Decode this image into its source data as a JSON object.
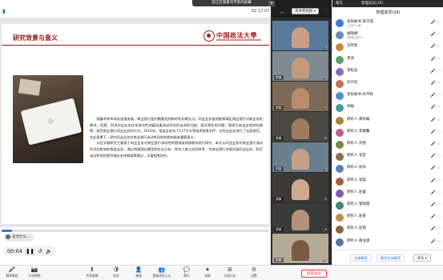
{
  "banner": {
    "text": "您正在观看刘宇新的屏幕",
    "close": "×"
  },
  "topbar": {
    "timer": "02:17:07",
    "view_label": "演讲者视图 ▾"
  },
  "slide": {
    "title": "研究背景与意义",
    "logo_text": "中国政法大學",
    "paragraphs": [
      "　　随着利率市场化加速发展，商业银行盈利需要找到新的利润增长点。同业业务虽然能够满足商业银行对新业务的需求，但是，利用同业业务优化流动性却蕴含着流动性风险出现的可能。面对潜在的问题，国家开始出台相关的政策，规范商业银行同业业务的行为。2014年，银监会发布了127号文等相关政策文件，对同业业务进行了全面规范。在此背景下，研究同业业务对商业银行流动性风险的影响具有重要意义。",
      "　　以往文献研究主要基于同业业务对商业银行流动性的直接或间接影响进行研究，本文从同业业务对商业银行流动性风险影响的角度出发，通过构建理论模型和实证分析，探究二者之间的关系，为商业银行合理开展同业业务、防范流动性风险提供理论支持和政策建议，丰富相关研究。"
    ]
  },
  "playback": {
    "chat_text": "说点什么...",
    "time": "00:04",
    "progress": 0.04
  },
  "videos": [
    {
      "name": "",
      "bg": "#5a7a9a",
      "skin": "#c89f86"
    },
    {
      "name": "李某",
      "bg": "#7f8a92",
      "skin": "#c49a7c"
    },
    {
      "name": "刘某",
      "bg": "#7c6a58",
      "skin": "#b88c6c"
    },
    {
      "name": "李某",
      "bg": "#4a4a42",
      "skin": "#a07a60"
    },
    {
      "name": "刘某",
      "bg": "#6a7f8e",
      "skin": "#c6a088"
    },
    {
      "name": "邵某",
      "bg": "#3c3a36",
      "skin": "#d0a890"
    },
    {
      "name": "邵某",
      "bg": "#3a3a3a",
      "skin": "#b69078"
    },
    {
      "name": "邵某",
      "bg": "#b4aa98",
      "skin": "#7a5a44"
    }
  ],
  "panel": {
    "tabs": {
      "chat": "聊天",
      "members": "管理成员(26)"
    },
    "title": "管理成员(26)",
    "participants": [
      {
        "name": "答辩秘书-朱学成",
        "role": "(主持人,我)",
        "color": "#3d7bd9"
      },
      {
        "name": "胡晓峰",
        "role": "(联席主持人)",
        "color": "#6b8db5"
      },
      {
        "name": "刘宇新",
        "role": "",
        "color": "#c58a3a"
      },
      {
        "name": "李涛",
        "role": "",
        "color": "#5a9e6f"
      },
      {
        "name": "李松岳",
        "role": "",
        "color": "#8e6bbf"
      },
      {
        "name": "孙宁纪",
        "role": "",
        "color": "#d0694f"
      },
      {
        "name": "答辩秘书-肖平秋",
        "role": "",
        "color": "#4f8fbf"
      },
      {
        "name": "林翰",
        "role": "",
        "color": "#3f9e9e"
      },
      {
        "name": "原听人 黄科翰",
        "role": "",
        "color": "#b0813f"
      },
      {
        "name": "原听人 李靓馨",
        "role": "",
        "color": "#c15d86"
      },
      {
        "name": "原听人 刘悦",
        "role": "",
        "color": "#6f8f3f"
      },
      {
        "name": "原听人 张亚",
        "role": "",
        "color": "#8d6d4d"
      },
      {
        "name": "原听人 徐凤",
        "role": "",
        "color": "#5a7fbf"
      },
      {
        "name": "原听人 张磊",
        "role": "",
        "color": "#a95c3c"
      },
      {
        "name": "原听人 赵蕾",
        "role": "",
        "color": "#7a5caf"
      },
      {
        "name": "原听人 邹晓霞",
        "role": "",
        "color": "#3c8c6c"
      },
      {
        "name": "原听人 赵某",
        "role": "",
        "color": "#bf8f4f"
      },
      {
        "name": "原听人 赵钱",
        "role": "",
        "color": "#8f5f3f"
      },
      {
        "name": "原听人 胡泊源",
        "role": "",
        "color": "#5f6f9f"
      }
    ],
    "footer": {
      "mute_all": "全体静音",
      "unmute_all": "解除全体静音",
      "more": "更多 ▾"
    }
  },
  "toolbar": {
    "items": [
      {
        "label": "解除静音",
        "icon": "🎤"
      },
      {
        "label": "开启视频",
        "icon": "📷"
      },
      {
        "label": "共享屏幕",
        "icon": "⬆"
      },
      {
        "label": "安全",
        "icon": "🛡"
      },
      {
        "label": "邀请",
        "icon": "👤"
      },
      {
        "label": "管理成员(26)",
        "icon": "👥"
      },
      {
        "label": "聊天",
        "icon": "💬"
      },
      {
        "label": "录制",
        "icon": "⏺"
      },
      {
        "label": "分组讨论",
        "icon": "⊞"
      },
      {
        "label": "设置",
        "icon": "⚙"
      }
    ],
    "end_label": "结束会议"
  }
}
